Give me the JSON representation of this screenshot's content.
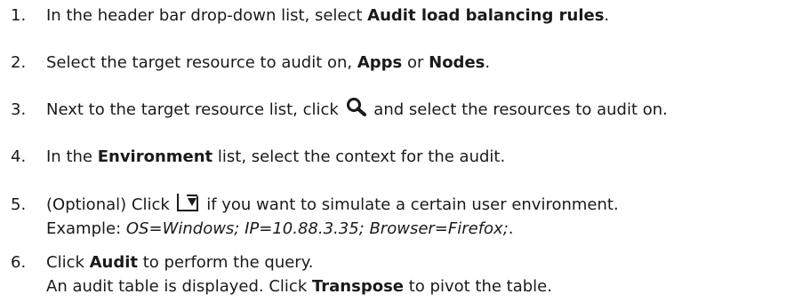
{
  "steps": [
    {
      "number": "1.",
      "pre": "In the header bar drop-down list, select ",
      "bold": "Audit load balancing rules",
      "post": "."
    },
    {
      "number": "2.",
      "pre": "Select the target resource to audit on, ",
      "bold1": "Apps",
      "mid": " or ",
      "bold2": "Nodes",
      "post": "."
    },
    {
      "number": "3.",
      "pre": "Next to the target resource list, click ",
      "icon": "search-icon",
      "post": " and select the resources to audit on."
    },
    {
      "number": "4.",
      "pre": "In the ",
      "bold": "Environment",
      "post": " list, select the context for the audit."
    },
    {
      "number": "5.",
      "pre": "(Optional) Click ",
      "icon": "filter-down-icon",
      "post": " if you want to simulate a certain user environment.",
      "line2_pre": "Example: ",
      "line2_italic": "OS=Windows; IP=10.88.3.35; Browser=Firefox;",
      "line2_post": "."
    },
    {
      "number": "6.",
      "pre": "Click ",
      "bold": "Audit",
      "post": " to perform the query.",
      "line2_pre": "An audit table is displayed. Click ",
      "line2_bold": "Transpose",
      "line2_post": " to pivot the table."
    }
  ]
}
